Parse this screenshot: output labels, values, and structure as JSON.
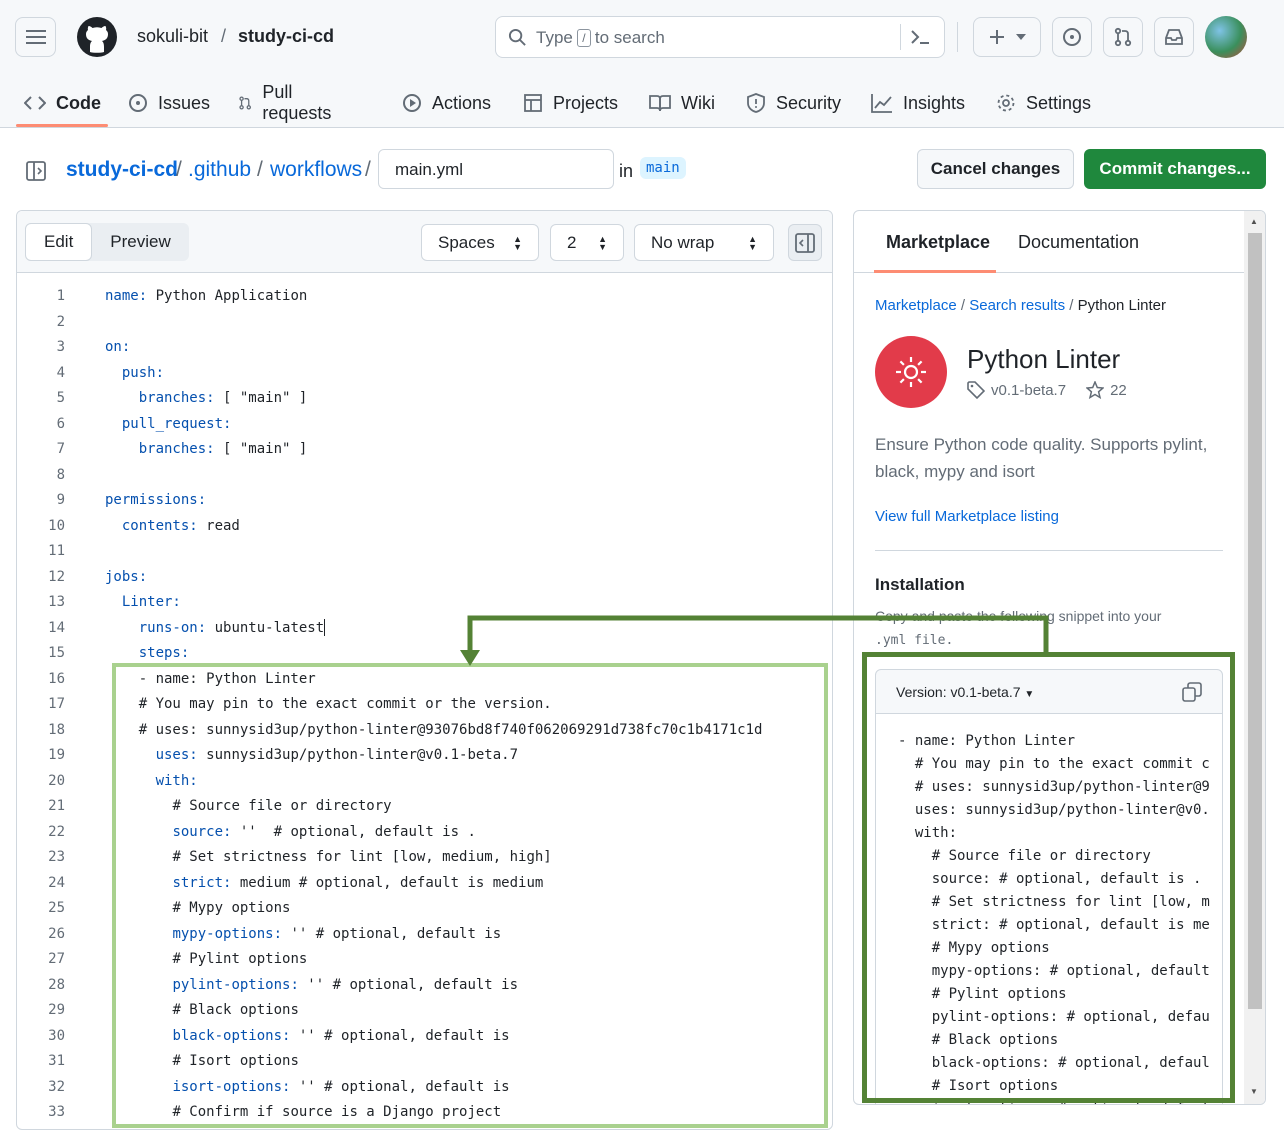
{
  "header": {
    "owner": "sokuli-bit",
    "slash": "/",
    "repo": "study-ci-cd",
    "search_prefix": "Type",
    "search_key": "/",
    "search_suffix": "to search"
  },
  "nav": {
    "tabs": [
      {
        "label": "Code"
      },
      {
        "label": "Issues"
      },
      {
        "label": "Pull requests"
      },
      {
        "label": "Actions"
      },
      {
        "label": "Projects"
      },
      {
        "label": "Wiki"
      },
      {
        "label": "Security"
      },
      {
        "label": "Insights"
      },
      {
        "label": "Settings"
      }
    ]
  },
  "breadcrumb": {
    "repo": "study-ci-cd",
    "dir1": ".github",
    "dir2": "workflows",
    "sep": "/",
    "filename": "main.yml",
    "in": "in",
    "branch": "main"
  },
  "actions": {
    "cancel": "Cancel changes",
    "commit": "Commit changes..."
  },
  "editor": {
    "edit_label": "Edit",
    "preview_label": "Preview",
    "indent_mode": "Spaces",
    "indent_size": "2",
    "wrap_mode": "No wrap",
    "lines": [
      {
        "n": "1",
        "key": "name:",
        "rest": " Python Application",
        "indent": ""
      },
      {
        "n": "2",
        "key": "",
        "rest": "",
        "indent": ""
      },
      {
        "n": "3",
        "key": "on:",
        "rest": "",
        "indent": ""
      },
      {
        "n": "4",
        "key": "push:",
        "rest": "",
        "indent": "  "
      },
      {
        "n": "5",
        "key": "branches:",
        "rest": " [ \"main\" ]",
        "indent": "    "
      },
      {
        "n": "6",
        "key": "pull_request:",
        "rest": "",
        "indent": "  "
      },
      {
        "n": "7",
        "key": "branches:",
        "rest": " [ \"main\" ]",
        "indent": "    "
      },
      {
        "n": "8",
        "key": "",
        "rest": "",
        "indent": ""
      },
      {
        "n": "9",
        "key": "permissions:",
        "rest": "",
        "indent": ""
      },
      {
        "n": "10",
        "key": "contents:",
        "rest": " read",
        "indent": "  "
      },
      {
        "n": "11",
        "key": "",
        "rest": "",
        "indent": ""
      },
      {
        "n": "12",
        "key": "jobs:",
        "rest": "",
        "indent": ""
      },
      {
        "n": "13",
        "key": "Linter:",
        "rest": "",
        "indent": "  "
      },
      {
        "n": "14",
        "key": "runs-on:",
        "rest": " ubuntu-latest",
        "indent": "    "
      },
      {
        "n": "15",
        "key": "steps:",
        "rest": "",
        "indent": "    "
      },
      {
        "n": "16",
        "key": "",
        "rest": "- name: Python Linter",
        "indent": "    "
      },
      {
        "n": "17",
        "key": "",
        "rest": "# You may pin to the exact commit or the version.",
        "indent": "    "
      },
      {
        "n": "18",
        "key": "",
        "rest": "# uses: sunnysid3up/python-linter@93076bd8f740f062069291d738fc70c1b4171c1d",
        "indent": "    "
      },
      {
        "n": "19",
        "key": "uses:",
        "rest": " sunnysid3up/python-linter@v0.1-beta.7",
        "indent": "      "
      },
      {
        "n": "20",
        "key": "with:",
        "rest": "",
        "indent": "      "
      },
      {
        "n": "21",
        "key": "",
        "rest": "# Source file or directory",
        "indent": "        "
      },
      {
        "n": "22",
        "key": "source:",
        "rest": " ''  # optional, default is .",
        "indent": "        "
      },
      {
        "n": "23",
        "key": "",
        "rest": "# Set strictness for lint [low, medium, high]",
        "indent": "        "
      },
      {
        "n": "24",
        "key": "strict:",
        "rest": " medium # optional, default is medium",
        "indent": "        "
      },
      {
        "n": "25",
        "key": "",
        "rest": "# Mypy options",
        "indent": "        "
      },
      {
        "n": "26",
        "key": "mypy-options:",
        "rest": " '' # optional, default is",
        "indent": "        "
      },
      {
        "n": "27",
        "key": "",
        "rest": "# Pylint options",
        "indent": "        "
      },
      {
        "n": "28",
        "key": "pylint-options:",
        "rest": " '' # optional, default is",
        "indent": "        "
      },
      {
        "n": "29",
        "key": "",
        "rest": "# Black options",
        "indent": "        "
      },
      {
        "n": "30",
        "key": "black-options:",
        "rest": " '' # optional, default is",
        "indent": "        "
      },
      {
        "n": "31",
        "key": "",
        "rest": "# Isort options",
        "indent": "        "
      },
      {
        "n": "32",
        "key": "isort-options:",
        "rest": " '' # optional, default is",
        "indent": "        "
      },
      {
        "n": "33",
        "key": "",
        "rest": "# Confirm if source is a Django project",
        "indent": "        "
      }
    ]
  },
  "side": {
    "tab_marketplace": "Marketplace",
    "tab_docs": "Documentation",
    "crumb_marketplace": "Marketplace",
    "crumb_sep": "/",
    "crumb_search": "Search results",
    "crumb_current": "Python Linter",
    "title": "Python Linter",
    "version_tag": "v0.1-beta.7",
    "stars": "22",
    "description": "Ensure Python code quality. Supports pylint, black, mypy and isort",
    "view_link": "View full Marketplace listing",
    "install_heading": "Installation",
    "install_desc_1": "Copy and paste the following snippet into your",
    "install_desc_2": ".yml file.",
    "snippet_version": "Version: v0.1-beta.7",
    "snippet_lines": [
      "- name: Python Linter",
      "  # You may pin to the exact commit c",
      "  # uses: sunnysid3up/python-linter@9",
      "  uses: sunnysid3up/python-linter@v0.",
      "  with:",
      "    # Source file or directory",
      "    source: # optional, default is .",
      "    # Set strictness for lint [low, m",
      "    strict: # optional, default is me",
      "    # Mypy options",
      "    mypy-options: # optional, default",
      "    # Pylint options",
      "    pylint-options: # optional, defau",
      "    # Black options",
      "    black-options: # optional, defaul",
      "    # Isort options",
      "    isort-options: # optional, defaul"
    ]
  },
  "colors": {
    "annotation_light": "#a9d18e",
    "annotation_dark": "#548235",
    "accent_green": "#1f883d",
    "link_blue": "#0969da"
  }
}
